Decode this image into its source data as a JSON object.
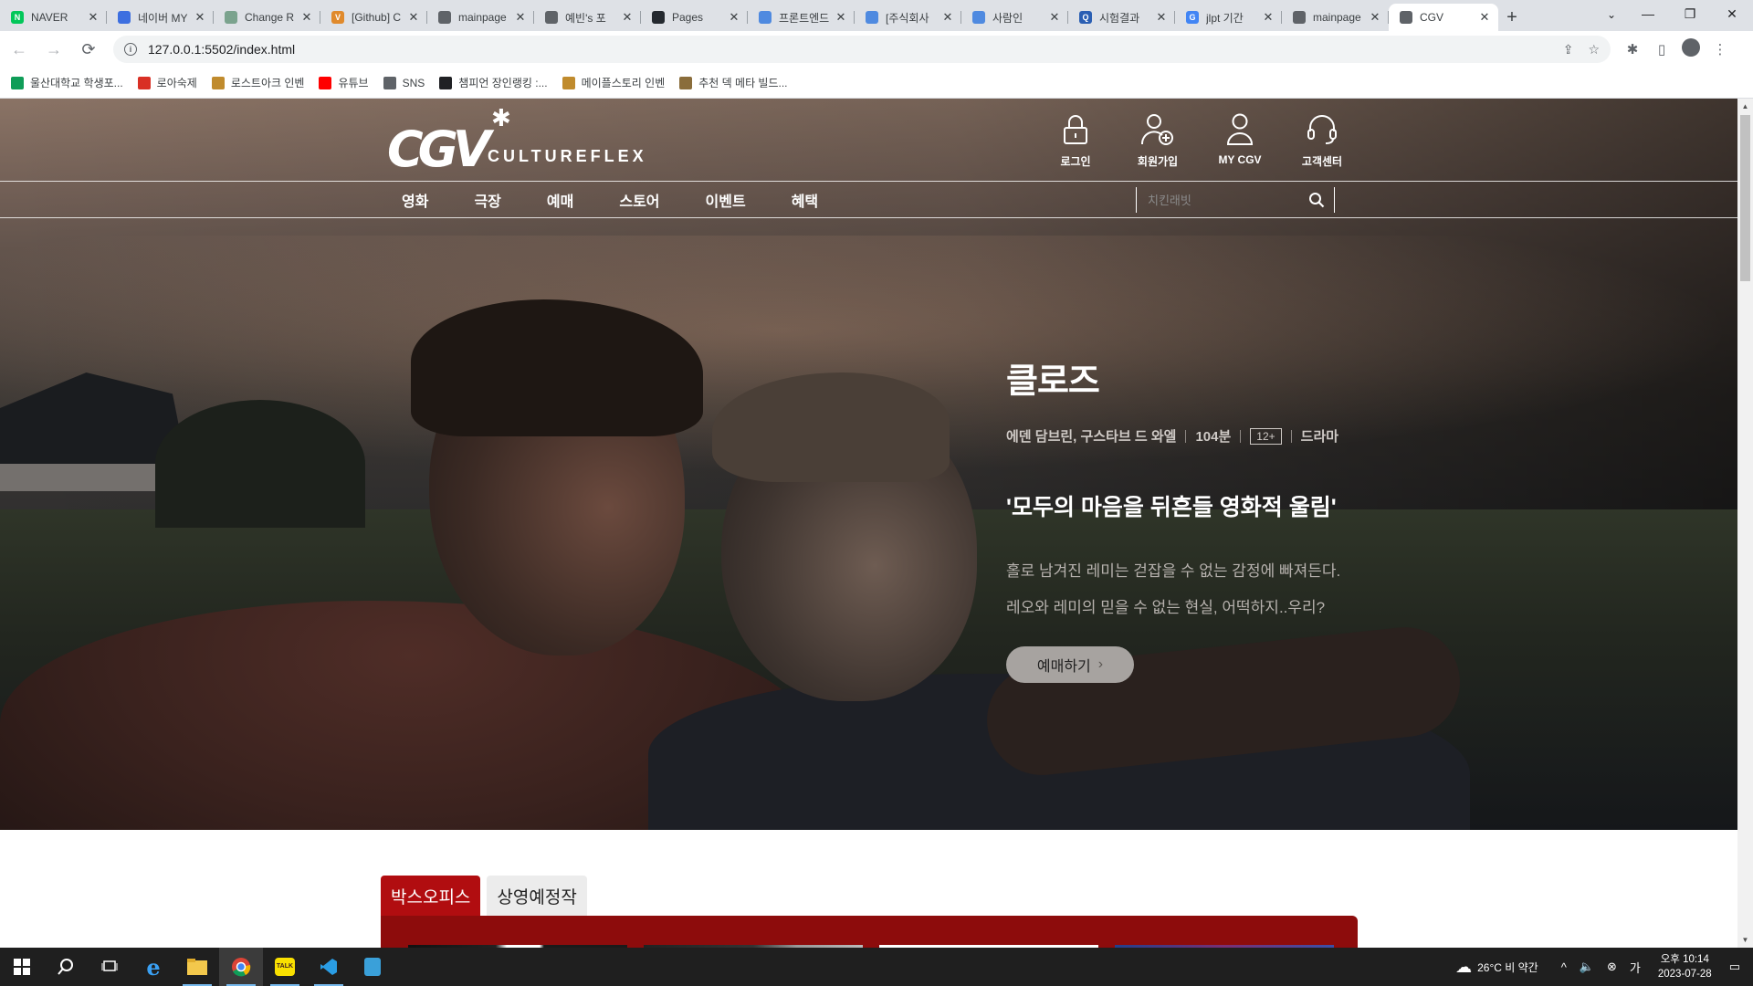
{
  "browser": {
    "tabs": [
      {
        "title": "NAVER",
        "favicon_color": "#03c75a",
        "favicon_glyph": "N"
      },
      {
        "title": "네이버 MY",
        "favicon_color": "#3d6fe0",
        "favicon_glyph": ""
      },
      {
        "title": "Change R",
        "favicon_color": "#7ba38e",
        "favicon_glyph": ""
      },
      {
        "title": "[Github] C",
        "favicon_color": "#e08a2c",
        "favicon_glyph": "V"
      },
      {
        "title": "mainpage",
        "favicon_color": "#5f6368",
        "favicon_glyph": ""
      },
      {
        "title": "예빈's 포",
        "favicon_color": "#5f6368",
        "favicon_glyph": ""
      },
      {
        "title": "Pages",
        "favicon_color": "#24292f",
        "favicon_glyph": ""
      },
      {
        "title": "프론트엔드",
        "favicon_color": "#4f8ae0",
        "favicon_glyph": ""
      },
      {
        "title": "[주식회사",
        "favicon_color": "#4f8ae0",
        "favicon_glyph": ""
      },
      {
        "title": "사람인",
        "favicon_color": "#4f8ae0",
        "favicon_glyph": ""
      },
      {
        "title": "시험결과",
        "favicon_color": "#2b5fb3",
        "favicon_glyph": "Q"
      },
      {
        "title": "jlpt 기간",
        "favicon_color": "#4285f4",
        "favicon_glyph": "G"
      },
      {
        "title": "mainpage",
        "favicon_color": "#5f6368",
        "favicon_glyph": ""
      },
      {
        "title": "CGV",
        "favicon_color": "#5f6368",
        "favicon_glyph": "",
        "active": true
      }
    ],
    "new_tab": "+",
    "window_controls": {
      "minimize": "—",
      "maximize": "❐",
      "close": "✕"
    },
    "url": "127.0.0.1:5502/index.html",
    "bookmarks": [
      {
        "label": "울산대학교 학생포...",
        "color": "#0f9d58"
      },
      {
        "label": "로아숙제",
        "color": "#d93025"
      },
      {
        "label": "로스트아크 인벤",
        "color": "#c08b2d"
      },
      {
        "label": "유튜브",
        "color": "#ff0000"
      },
      {
        "label": "SNS",
        "color": "#5f6368"
      },
      {
        "label": "챔피언 장인랭킹 :...",
        "color": "#202124"
      },
      {
        "label": "메이플스토리 인벤",
        "color": "#c08b2d"
      },
      {
        "label": "추천 덱 메타 빌드...",
        "color": "#8a6d3b"
      }
    ]
  },
  "header": {
    "logo_main": "CGV",
    "logo_sub": "CULTUREFLEX",
    "util": [
      {
        "label": "로그인",
        "icon": "lock-icon"
      },
      {
        "label": "회원가입",
        "icon": "add-user-icon"
      },
      {
        "label": "MY CGV",
        "icon": "user-icon"
      },
      {
        "label": "고객센터",
        "icon": "headset-icon"
      }
    ],
    "nav": [
      "영화",
      "극장",
      "예매",
      "스토어",
      "이벤트",
      "혜택"
    ],
    "search": {
      "placeholder": "치킨래빗",
      "value": ""
    }
  },
  "hero": {
    "title": "클로즈",
    "cast": "에덴 담브린, 구스타브 드 와엘",
    "runtime": "104분",
    "rating": "12+",
    "genre": "드라마",
    "tagline": "'모두의 마음을 뒤흔들 영화적 울림'",
    "desc_line1": "홀로 남겨진 레미는 걷잡을 수 없는 감정에 빠져든다.",
    "desc_line2": "레오와 레미의 믿을 수 없는 현실, 어떡하지..우리?",
    "book_label": "예매하기"
  },
  "movies": {
    "tabs": [
      "박스오피스",
      "상영예정작"
    ],
    "active_tab": 0
  },
  "taskbar": {
    "weather": "26°C  비 약간",
    "ime": "가",
    "time": "오후 10:14",
    "date": "2023-07-28"
  }
}
